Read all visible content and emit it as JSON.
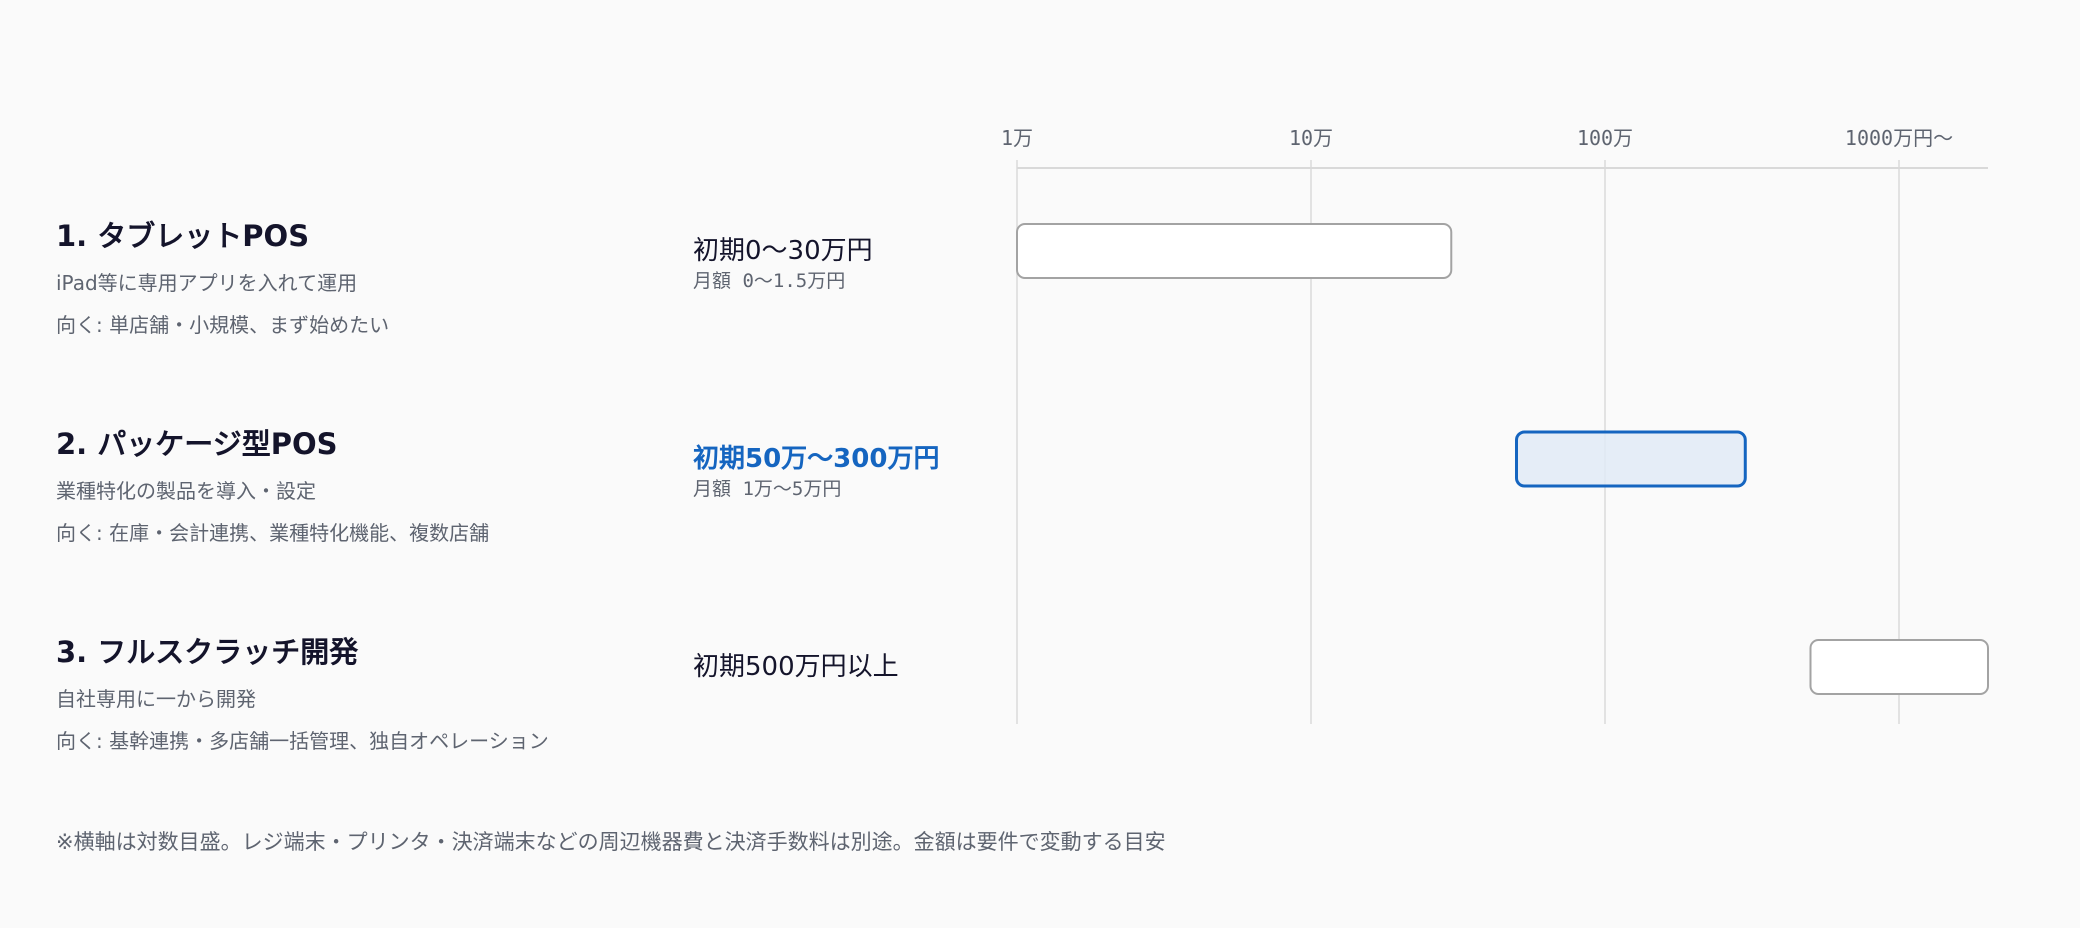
{
  "rows": [
    {
      "title": "1. タブレットPOS",
      "desc": "iPad等に専用アプリを入れて運用",
      "fit": "向く: 単店舗・小規模、まず始めたい",
      "price_main": "初期0〜30万円",
      "price_sub": "月額 0〜1.5万円"
    },
    {
      "title": "2. パッケージ型POS",
      "desc": "業種特化の製品を導入・設定",
      "fit": "向く: 在庫・会計連携、業種特化機能、複数店舗",
      "price_main": "初期50万〜300万円",
      "price_sub": "月額 1万〜5万円"
    },
    {
      "title": "3. フルスクラッチ開発",
      "desc": "自社専用に一から開発",
      "fit": "向く: 基幹連携・多店舗一括管理、独自オペレーション",
      "price_main": "初期500万円以上",
      "price_sub": ""
    }
  ],
  "chart_data": {
    "type": "bar",
    "orientation": "horizontal",
    "scale": "log",
    "unit": "万円",
    "xlim": [
      1,
      3000
    ],
    "ticks": [
      {
        "value": 1,
        "label": "1万"
      },
      {
        "value": 10,
        "label": "10万"
      },
      {
        "value": 100,
        "label": "100万"
      },
      {
        "value": 1000,
        "label": "1000万円〜"
      }
    ],
    "categories": [
      "1. タブレットPOS",
      "2. パッケージ型POS",
      "3. フルスクラッチ開発"
    ],
    "ranges": [
      {
        "start": 1,
        "end": 30
      },
      {
        "start": 50,
        "end": 300
      },
      {
        "start": 500,
        "end": 3000
      }
    ],
    "highlight_index": 1,
    "grid": true
  },
  "colors": {
    "accent": "#1565c0",
    "accent_fill": "#e1eaf6",
    "bar_stroke": "#a3a3a3",
    "bar_fill": "#ffffff",
    "grid": "#d9d9d9",
    "text_muted": "#5e6470",
    "text_main": "#14142b"
  },
  "footnote": "※横軸は対数目盛。レジ端末・プリンタ・決済端末などの周辺機器費と決済手数料は別途。金額は要件で変動する目安"
}
